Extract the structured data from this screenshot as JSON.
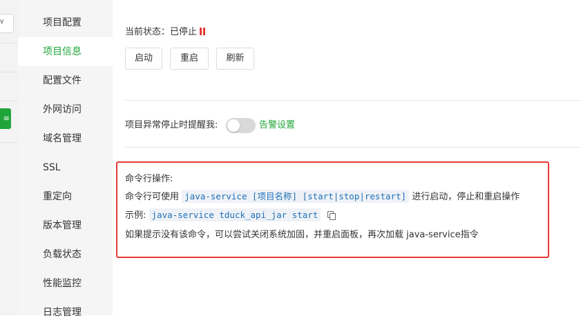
{
  "sidebar": {
    "items": [
      {
        "label": "项目配置",
        "active": false
      },
      {
        "label": "项目信息",
        "active": true
      },
      {
        "label": "配置文件",
        "active": false
      },
      {
        "label": "外网访问",
        "active": false
      },
      {
        "label": "域名管理",
        "active": false
      },
      {
        "label": "SSL",
        "active": false
      },
      {
        "label": "重定向",
        "active": false
      },
      {
        "label": "版本管理",
        "active": false
      },
      {
        "label": "负载状态",
        "active": false
      },
      {
        "label": "性能监控",
        "active": false
      },
      {
        "label": "日志管理",
        "active": false
      }
    ]
  },
  "status": {
    "label": "当前状态：",
    "value": "已停止"
  },
  "buttons": {
    "start": "启动",
    "restart": "重启",
    "refresh": "刷新"
  },
  "alert": {
    "label": "项目异常停止时提醒我:",
    "toggle_on": false,
    "link": "告警设置"
  },
  "command": {
    "title": "命令行操作:",
    "usage_prefix": "命令行可使用",
    "usage_code": "java-service [项目名称] [start|stop|restart]",
    "usage_suffix": "进行启动，停止和重启操作",
    "example_label": "示例:",
    "example_code": "java-service tduck_api_jar start",
    "hint": "如果提示没有该命令，可以尝试关闭系统加固，并重启面板，再次加载 java-service指令"
  },
  "colors": {
    "accent": "#20a53a",
    "stopped": "#e53935",
    "code": "#1f6fb8"
  }
}
